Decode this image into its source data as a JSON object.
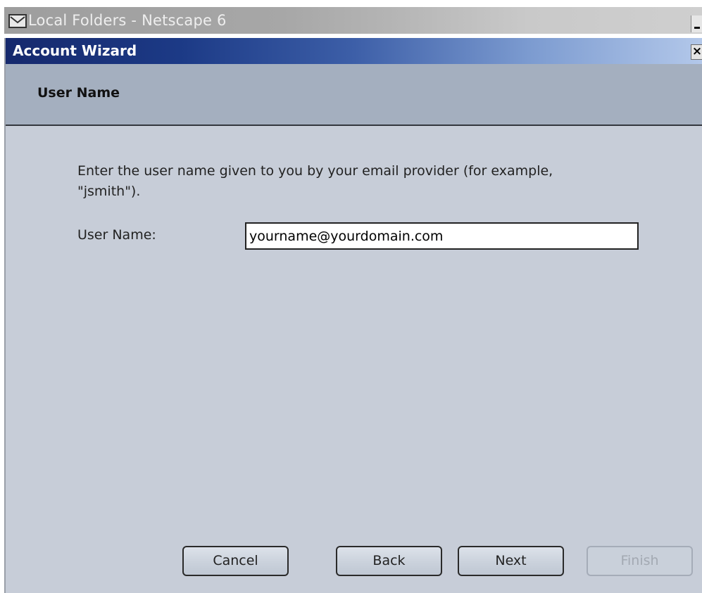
{
  "parent_window": {
    "title": "Local Folders - Netscape 6",
    "app_icon": "mail-icon",
    "minimize_icon": "minimize-icon"
  },
  "dialog": {
    "title": "Account Wizard",
    "close_label": "×",
    "close_icon": "close-icon"
  },
  "page": {
    "title": "User Name",
    "description": "Enter the user name given to you by your email provider (for example, \"jsmith\").",
    "field_label": "User Name:",
    "username_value": "yourname@yourdomain.com"
  },
  "buttons": {
    "cancel": "Cancel",
    "back": "Back",
    "next": "Next",
    "finish": "Finish"
  },
  "colors": {
    "dialog_background": "#c7cdd8",
    "header_band": "#a4afbf",
    "titlebar_start": "#16296d",
    "titlebar_end": "#b3c8ea",
    "disabled_text": "#a3a9b2"
  }
}
